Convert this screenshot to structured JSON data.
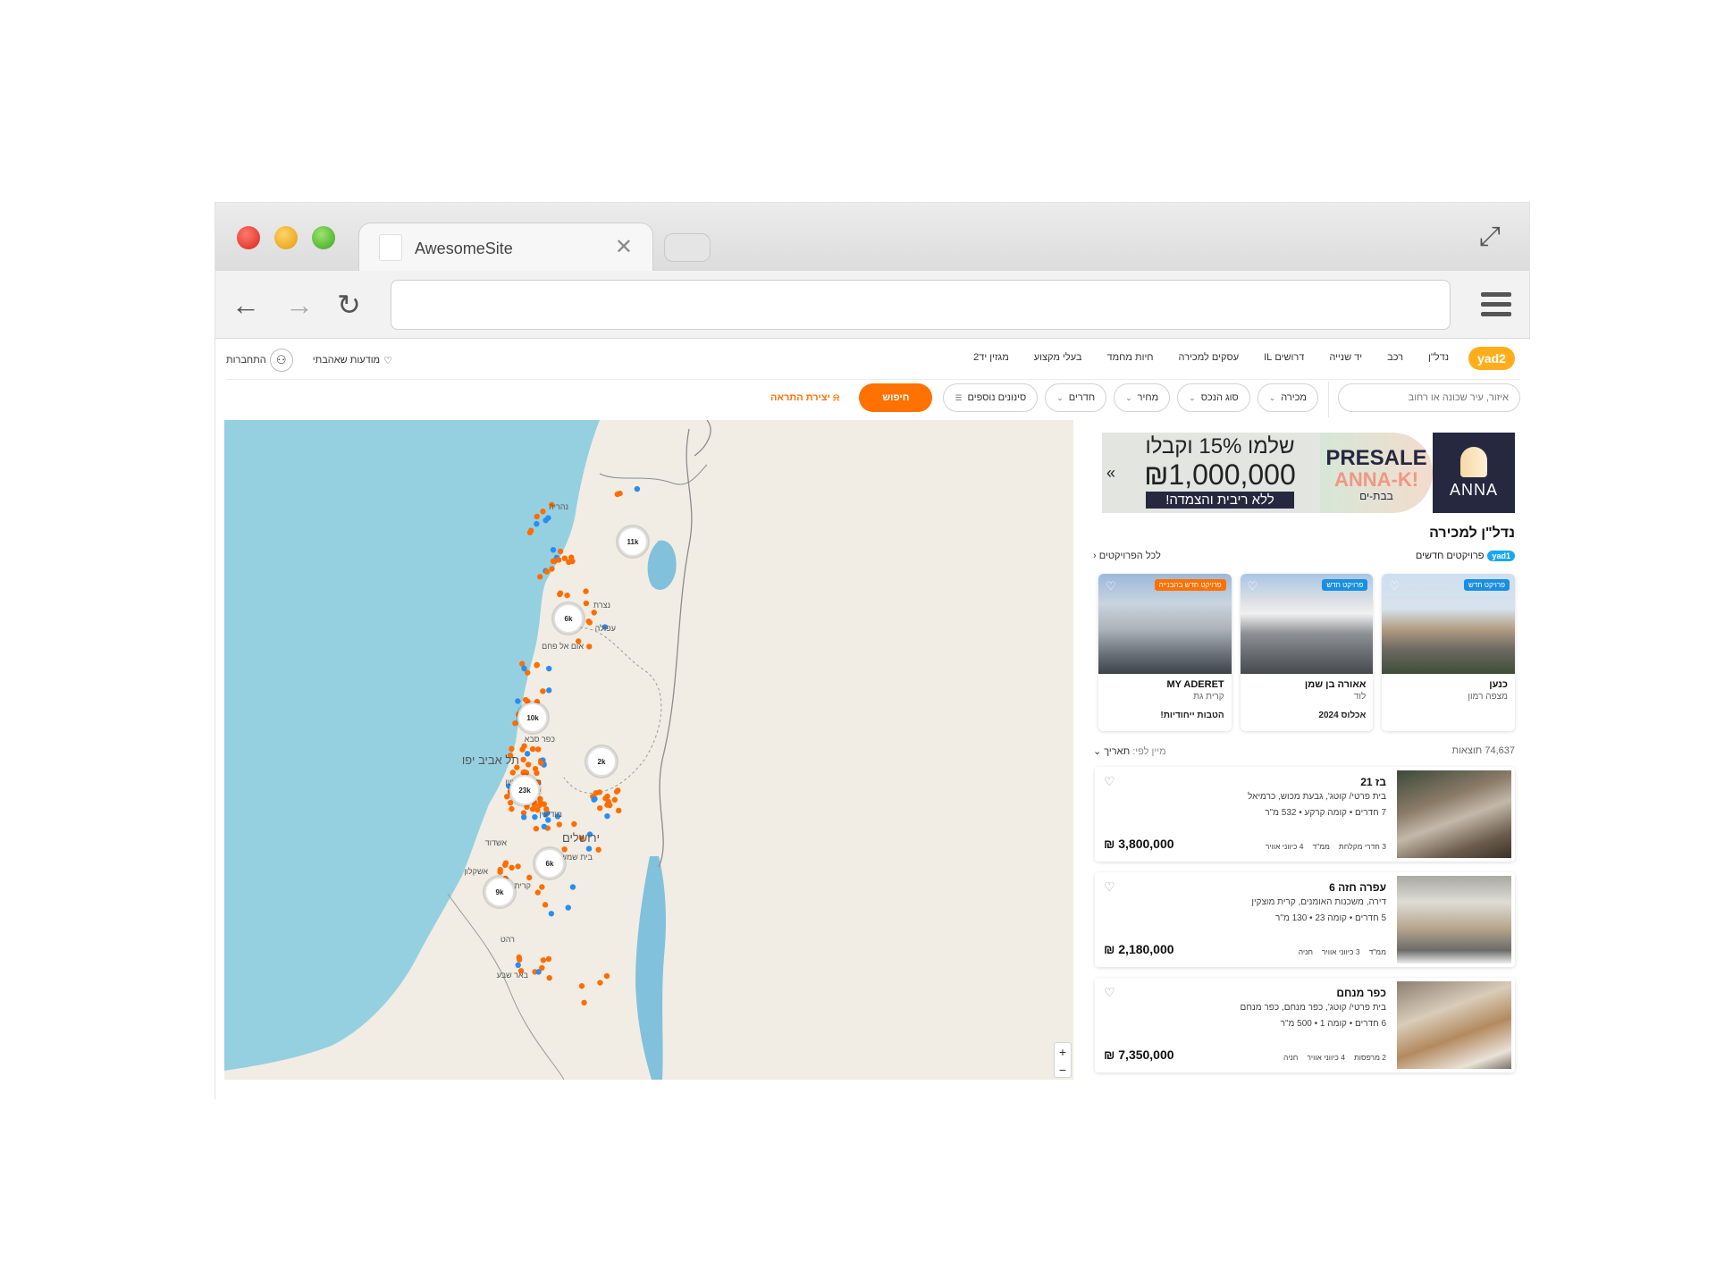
{
  "browser": {
    "tab_title": "AwesomeSite",
    "tab_close": "✕",
    "back": "←",
    "forward": "→",
    "reload": "↻",
    "expand": "⤢"
  },
  "nav": {
    "logo": "yad2",
    "links": [
      "נדל\"ן",
      "רכב",
      "יד שנייה",
      "דרושים IL",
      "עסקים למכירה",
      "חיות מחמד",
      "בעלי מקצוע",
      "מגזין יד2"
    ],
    "favorites": "מודעות שאהבתי",
    "login": "התחברות"
  },
  "filters": {
    "search_placeholder": "איזור, עיר שכונה או רחוב",
    "chips": [
      "מכירה",
      "סוג הנכס",
      "מחיר",
      "חדרים"
    ],
    "more_filters": "סינונים נוספים",
    "search_button": "חיפוש",
    "create_alert": "יצירת התראה"
  },
  "banner": {
    "offer_line1": "שלמו 15% וקבלו",
    "offer_line2": "₪1,000,000",
    "offer_line3": "ללא ריבית והצמדה!",
    "presale_line1": "PRESALE",
    "presale_line2": "ANNA-K!",
    "presale_line3": "בבת-ים",
    "brand": "ANNA",
    "arrow": "«"
  },
  "section_title": "נדל\"ן למכירה",
  "projects": {
    "tag": "yad1",
    "label": "פרויקטים חדשים",
    "all_link": "לכל הפרויקטים",
    "cards": [
      {
        "badge": "פרויקט חדש",
        "name": "כנען",
        "city": "מצפה רמון",
        "note": ""
      },
      {
        "badge": "פרויקט חדש",
        "name": "אאורה בן שמן",
        "city": "לוד",
        "note": "אכלוס 2024"
      },
      {
        "badge": "פרויקט חדש בהבנייה",
        "name": "MY ADERET",
        "city": "קרית גת",
        "note": "הטבות ייחודיות!"
      }
    ]
  },
  "results": {
    "count": "74,637 תוצאות",
    "sort_label": "מיין לפי:",
    "sort_value": "תאריך"
  },
  "listings": [
    {
      "title": "בז 21",
      "address": "בית פרטי/ קוטג', גבעת מכוש, כרמיאל",
      "details": "7 חדרים • קומה קרקע • 532 מ\"ר",
      "tags": [
        "3 חדרי מקלחת",
        "ממ\"ד",
        "4 כיווני אוויר"
      ],
      "price": "₪ 3,800,000"
    },
    {
      "title": "עפרה חזה 6",
      "address": "דירה, משכנות האומנים, קרית מוצקין",
      "details": "5 חדרים • קומה 23 • 130 מ\"ר",
      "tags": [
        "ממ\"ד",
        "3 כיווני אוויר",
        "חניה"
      ],
      "price": "₪ 2,180,000"
    },
    {
      "title": "כפר מנחם",
      "address": "בית פרטי/ קוטג', כפר מנחם, כפר מנחם",
      "details": "6 חדרים • קומה 1 • 500 מ\"ר",
      "tags": [
        "2 מרפסות",
        "4 כיווני אוויר",
        "חניה"
      ],
      "price": "₪ 7,350,000"
    }
  ],
  "map": {
    "clusters": [
      "11k",
      "6k",
      "10k",
      "2k",
      "23k",
      "6k",
      "9k"
    ],
    "places": [
      "נהריה",
      "נצרת",
      "עפולה",
      "אום אל פחם",
      "כפר סבא",
      "תל אביב יפו",
      "ראשון לציון",
      "מודיעין",
      "ירושלים",
      "אשדוד",
      "אשקלון",
      "בית שמש",
      "קרית גת",
      "רהט",
      "באר שבע"
    ],
    "zoom_in": "+",
    "zoom_out": "−",
    "colors": {
      "sea": "#95d0e0",
      "land": "#f1ede4",
      "lake": "#82c1dc",
      "dot_orange": "#ff6d00",
      "dot_blue": "#2a8df0"
    }
  }
}
